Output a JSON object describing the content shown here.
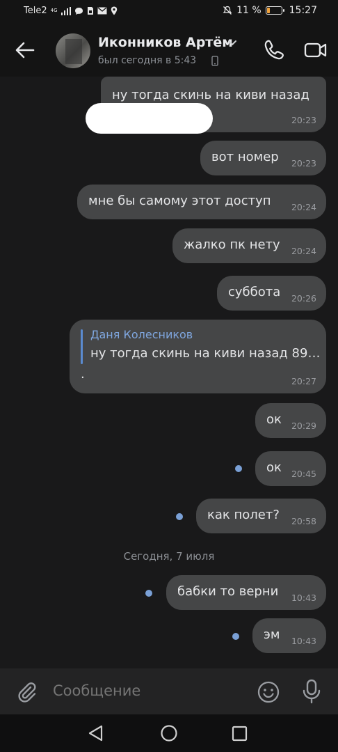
{
  "status_bar": {
    "carrier": "Tele2",
    "network": "4G",
    "battery_percent": "11 %",
    "time": "15:27"
  },
  "header": {
    "contact_name": "Иконников Артём",
    "contact_status": "был сегодня в 5:43"
  },
  "messages": [
    {
      "text": "ну тогда скинь на киви назад",
      "time": "20:23"
    },
    {
      "text": "вот номер",
      "time": "20:23"
    },
    {
      "text": "мне бы самому этот доступ",
      "time": "20:24"
    },
    {
      "text": "жалко пк нету",
      "time": "20:24"
    },
    {
      "text": "суббота",
      "time": "20:26"
    },
    {
      "reply_author": "Даня Колесников",
      "reply_text": "ну тогда скинь на киви назад 89…",
      "text": ".",
      "time": "20:27"
    },
    {
      "text": "ок",
      "time": "20:29"
    },
    {
      "text": "ок",
      "time": "20:45"
    },
    {
      "text": "как полет?",
      "time": "20:58"
    },
    {
      "text": "бабки то верни",
      "time": "10:43"
    },
    {
      "text": "эм",
      "time": "10:43"
    }
  ],
  "date_separator": "Сегодня, 7 июля",
  "composer": {
    "placeholder": "Сообщение"
  },
  "colors": {
    "bubble": "#454647",
    "background": "#19191a",
    "accent": "#7aa0d6"
  }
}
